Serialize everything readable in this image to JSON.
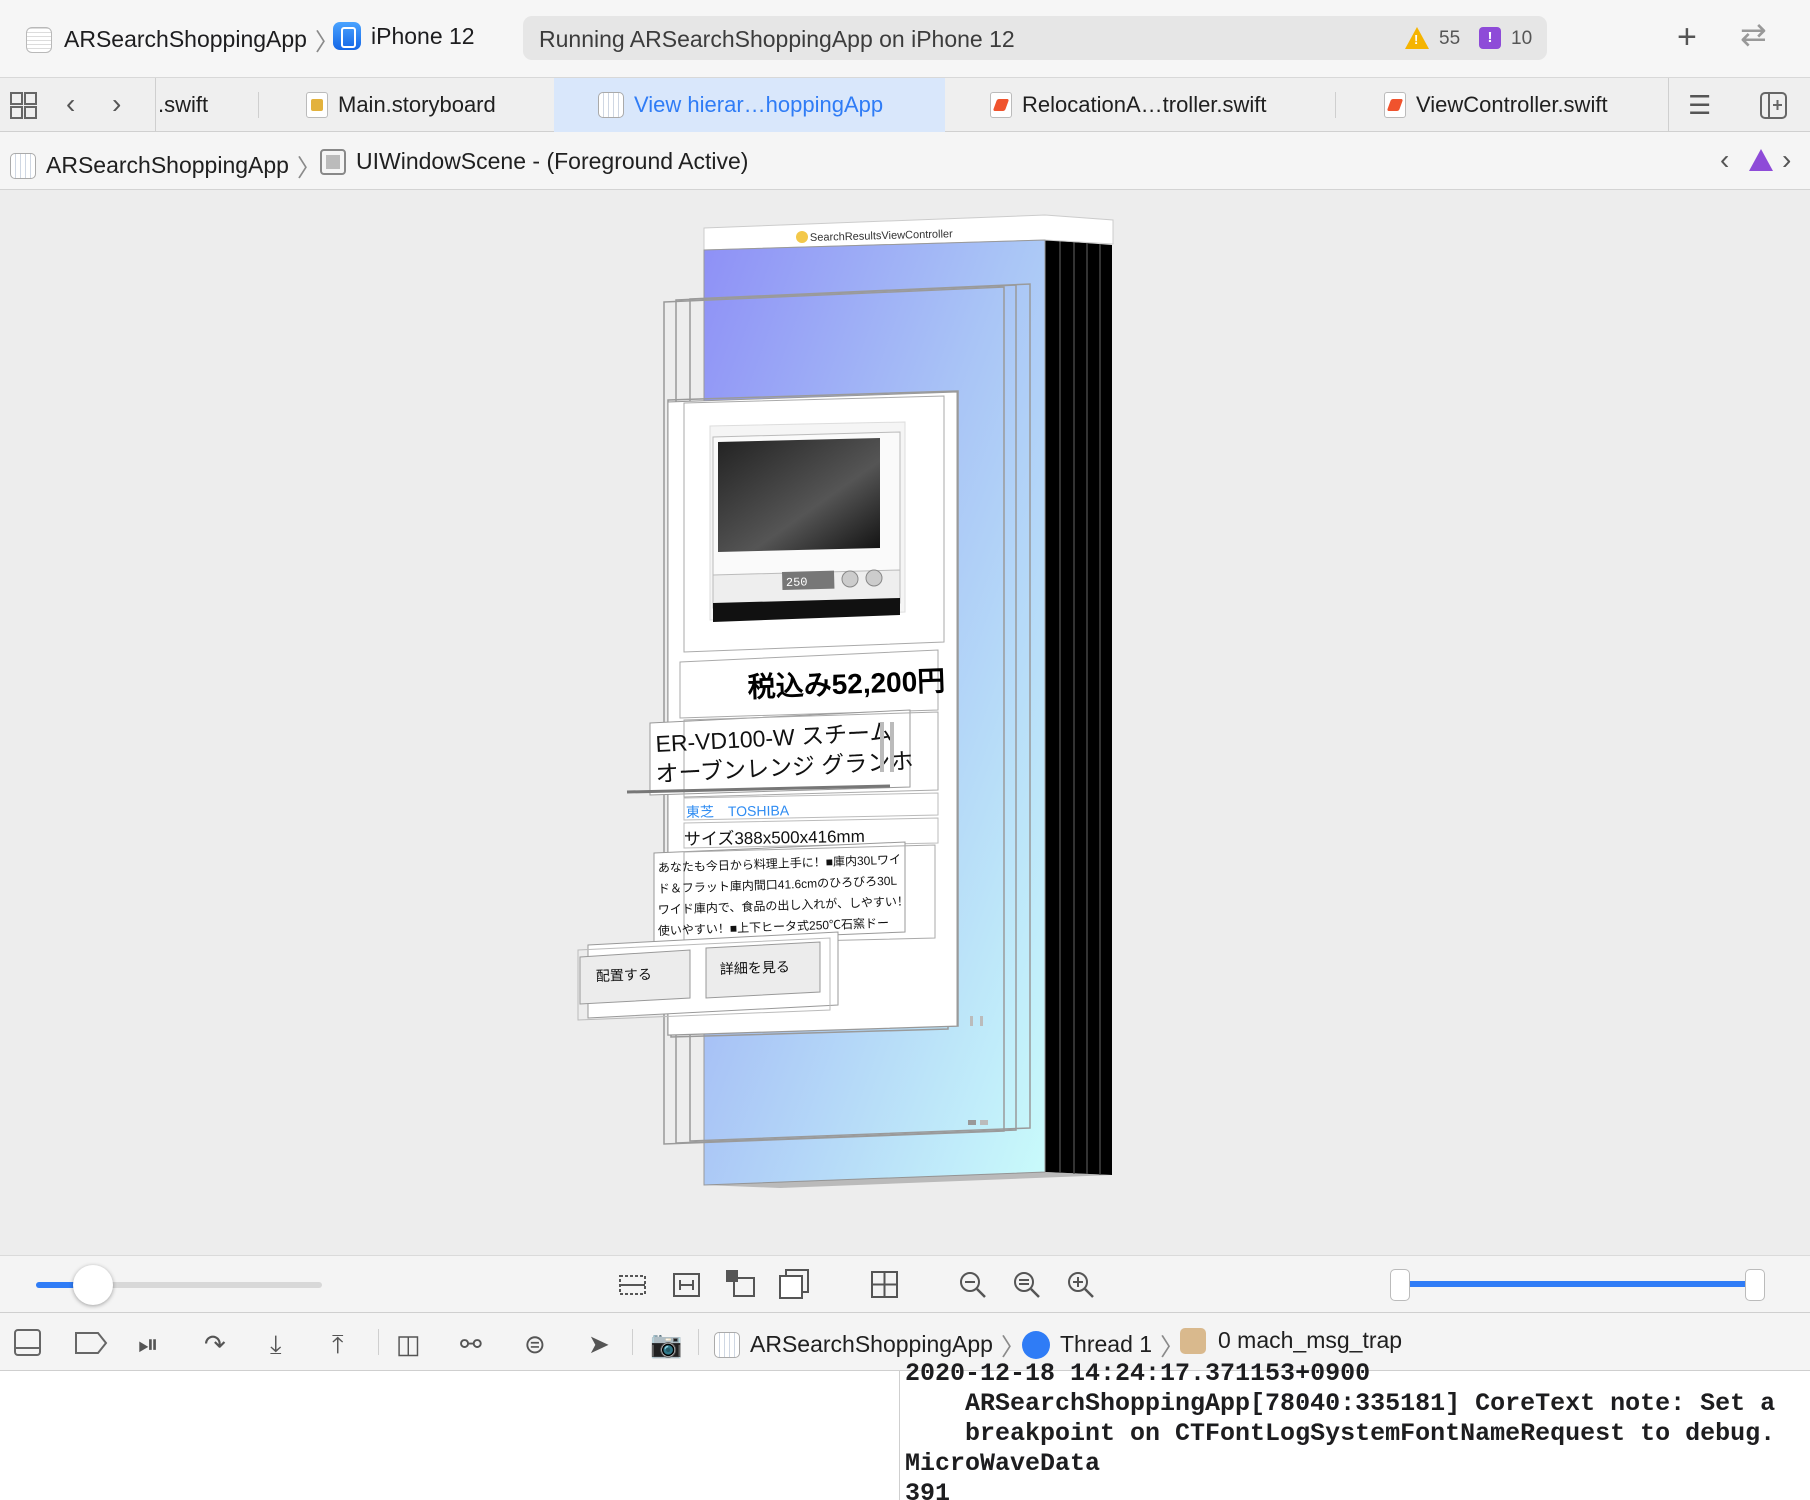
{
  "toolbar": {
    "scheme_app": "ARSearchShoppingApp",
    "scheme_device": "iPhone 12",
    "activity_status": "Running ARSearchShoppingApp on iPhone 12",
    "warning_count": "55",
    "issue_count": "10",
    "add_icon": "plus-icon",
    "split_icon": "arrows-icon"
  },
  "tabs": [
    {
      "label": ".swift",
      "type": "swift"
    },
    {
      "label": "Main.storyboard",
      "type": "storyboard"
    },
    {
      "label": "View hierar…hoppingApp",
      "type": "view-hierarchy",
      "active": true
    },
    {
      "label": "RelocationA…troller.swift",
      "type": "swift"
    },
    {
      "label": "ViewController.swift",
      "type": "swift"
    }
  ],
  "jumpbar": {
    "app": "ARSearchShoppingApp",
    "scene": "UIWindowScene - (Foreground Active)"
  },
  "hierarchy": {
    "controller_label": "SearchResultsViewController",
    "price": "税込み52,200円",
    "product_name_line1": "ER-VD100-W スチーム",
    "product_name_line2": "オーブンレンジ グランホ",
    "brand": "東芝　TOSHIBA",
    "size": "サイズ388x500x416mm",
    "description_lines": [
      "あなたも今日から料理上手に！■庫内30Lワイ",
      "ド＆フラット庫内間口41.6cmのひろびろ30L",
      "ワイド庫内で、食品の出し入れが、しやすい！",
      "使いやすい！■上下ヒータ式250℃石窯ドー"
    ],
    "button_place": "配置する",
    "button_details": "詳細を見る",
    "microwave_display": "250"
  },
  "canvas_controls": {
    "spacing_slider": 0.2,
    "range_slider_min": 0.0,
    "range_slider_max": 1.0
  },
  "debugbar": {
    "app": "ARSearchShoppingApp",
    "thread": "Thread 1",
    "frame": "0 mach_msg_trap"
  },
  "console": {
    "lines": [
      "2020-12-18 14:24:17.371153+0900",
      "    ARSearchShoppingApp[78040:335181] CoreText note: Set a",
      "    breakpoint on CTFontLogSystemFontNameRequest to debug.",
      "MicroWaveData",
      "391"
    ]
  }
}
